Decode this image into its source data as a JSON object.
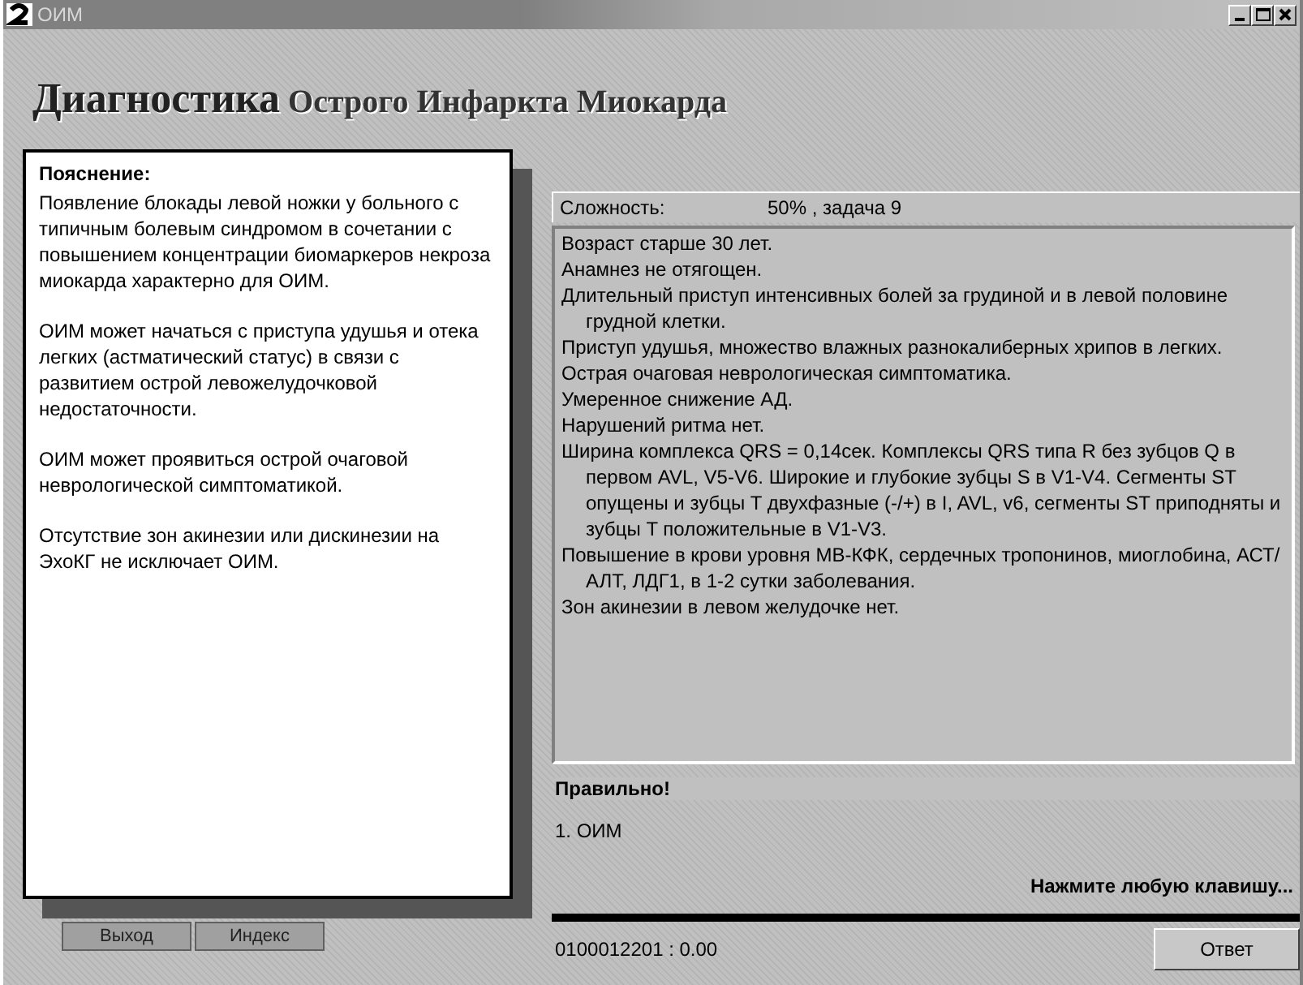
{
  "window": {
    "title": "ОИМ"
  },
  "header": {
    "title": "**Диагностика** Острого Инфаркта Миокарда"
  },
  "explanation": {
    "heading": "Пояснение:",
    "paragraphs": [
      "Появление блокады левой ножки у больного с типичным болевым синдромом в сочетании с повышением концентрации биомаркеров некроза миокарда характерно для ОИМ.",
      "ОИМ может начаться с приступа удушья и отека легких (астматический статус) в связи с развитием острой левожелудочковой недостаточности.",
      "ОИМ может проявиться острой очаговой неврологической симптоматикой.",
      "Отсутствие зон акинезии или дискинезии на ЭхоКГ не исключает ОИМ."
    ]
  },
  "task": {
    "difficulty_label": "Сложность:",
    "difficulty_value": "50% , задача  9",
    "findings": [
      "Возраст старше 30 лет.",
      "Анамнез не отягощен.",
      "Длительный приступ интенсивных болей за грудиной и в левой половине грудной клетки.",
      "Приступ удушья, множество влажных разнокалиберных хрипов в легких.",
      "Острая очаговая неврологическая симптоматика.",
      "Умеренное снижение АД.",
      "Нарушений ритма нет.",
      "Ширина комплекса QRS = 0,14сек. Комплексы QRS типа R без зубцов Q в первом AVL, V5-V6. Широкие и глубокие зубцы S в V1-V4. Сегменты ST опущены и зубцы T двухфазные (-/+) в I, AVL, v6, сегменты ST приподняты и зубцы T положительные в V1-V3.",
      "Повышение в крови уровня МВ-КФК, сердечных тропонинов, миоглобина, АСТ/АЛТ, ЛДГ1, в 1-2 сутки заболевания.",
      "Зон акинезии в левом желудочке нет."
    ]
  },
  "result": {
    "verdict": "Правильно!",
    "answers": [
      "1. ОИМ"
    ],
    "prompt": "Нажмите любую клавишу..."
  },
  "footer": {
    "buttons": [
      {
        "label": "Выход"
      },
      {
        "label": "Индекс"
      }
    ],
    "code": "0100012201 : 0.00",
    "answer_button": "Ответ"
  }
}
